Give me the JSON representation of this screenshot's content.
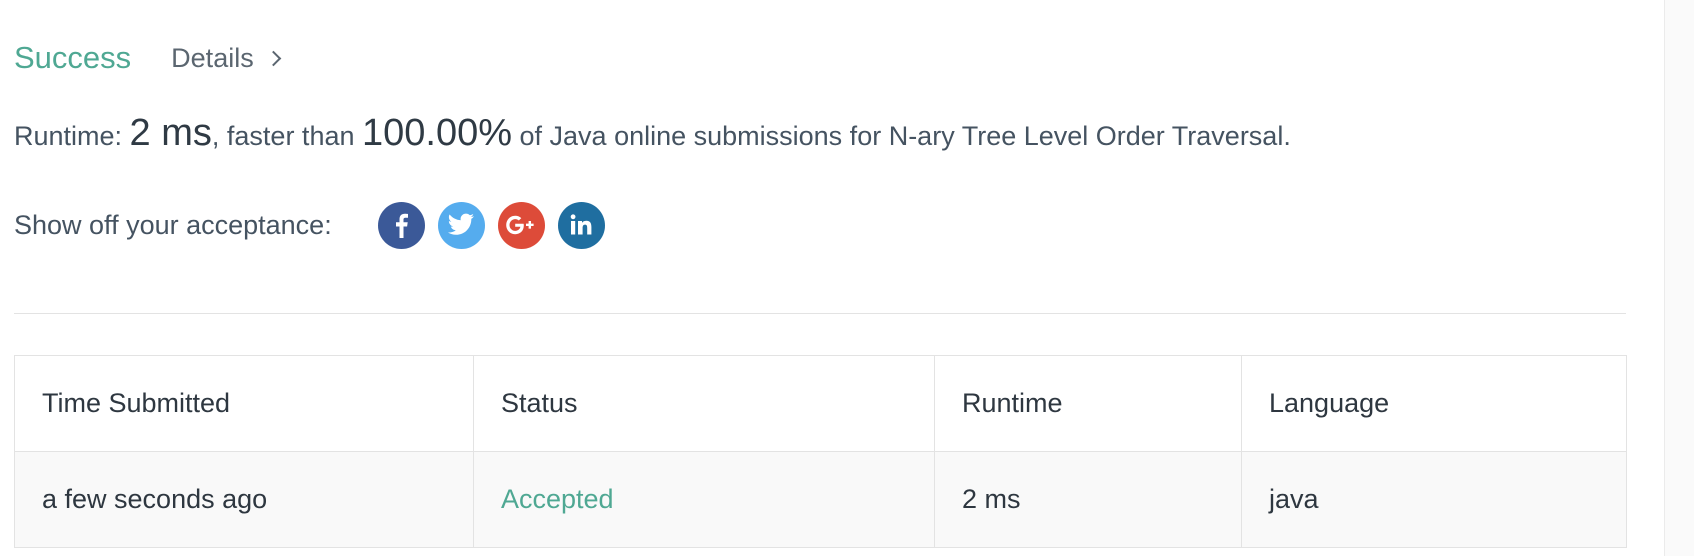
{
  "result": {
    "status": "Success",
    "details_label": "Details"
  },
  "runtime_summary": {
    "prefix": "Runtime: ",
    "runtime_value": "2 ms",
    "middle": ", faster than ",
    "percentile": "100.00%",
    "suffix": " of Java online submissions for N-ary Tree Level Order Traversal."
  },
  "share": {
    "label": "Show off your acceptance:",
    "buttons": [
      {
        "name": "facebook",
        "color": "#3b5998"
      },
      {
        "name": "twitter",
        "color": "#55acee"
      },
      {
        "name": "google-plus",
        "color": "#dd4b39"
      },
      {
        "name": "linkedin",
        "color": "#0e76a8"
      }
    ]
  },
  "submissions": {
    "columns": [
      "Time Submitted",
      "Status",
      "Runtime",
      "Language"
    ],
    "rows": [
      {
        "time": "a few seconds ago",
        "status": "Accepted",
        "runtime": "2 ms",
        "language": "java"
      }
    ]
  },
  "colors": {
    "success": "#4fa893",
    "text": "#3a4652"
  }
}
